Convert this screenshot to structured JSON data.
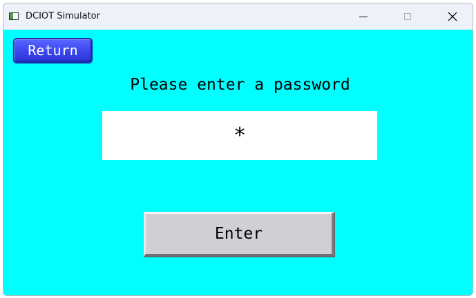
{
  "window": {
    "title": "DCIOT Simulator"
  },
  "controls": {
    "minimize_icon": "minimize-icon",
    "maximize_icon": "maximize-icon",
    "close_icon": "close-icon"
  },
  "screen": {
    "background_color": "#00ffff",
    "return_label": "Return",
    "prompt": "Please enter a password",
    "password_value": "*",
    "enter_label": "Enter"
  },
  "colors": {
    "return_button": "#3b46ee",
    "enter_button": "#d1ced6",
    "field": "#ffffff"
  }
}
